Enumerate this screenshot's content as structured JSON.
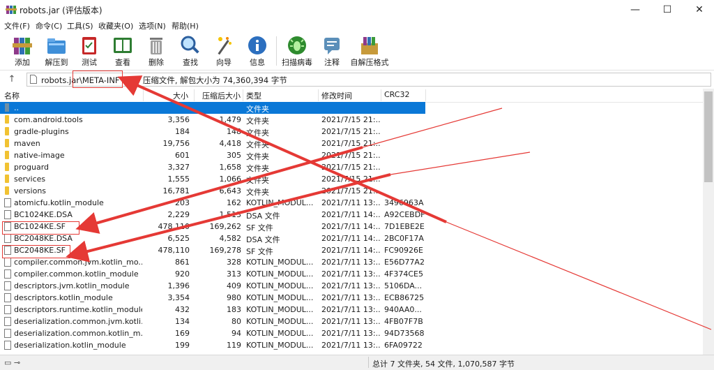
{
  "window": {
    "title": "robots.jar (评估版本)",
    "controls": {
      "minimize": "—",
      "maximize": "☐",
      "close": "✕"
    }
  },
  "menu": [
    "文件(F)",
    "命令(C)",
    "工具(S)",
    "收藏夹(O)",
    "选项(N)",
    "帮助(H)"
  ],
  "toolbar": [
    {
      "label": "添加",
      "icon": "books-add-icon"
    },
    {
      "label": "解压到",
      "icon": "folder-extract-icon"
    },
    {
      "label": "测试",
      "icon": "clipboard-test-icon"
    },
    {
      "label": "查看",
      "icon": "book-view-icon"
    },
    {
      "label": "删除",
      "icon": "trash-delete-icon"
    },
    {
      "label": "查找",
      "icon": "magnifier-find-icon"
    },
    {
      "label": "向导",
      "icon": "wand-wizard-icon"
    },
    {
      "label": "信息",
      "icon": "info-icon"
    },
    {
      "label": "扫描病毒",
      "icon": "bug-scan-icon"
    },
    {
      "label": "注释",
      "icon": "comment-icon"
    },
    {
      "label": "自解压格式",
      "icon": "sfx-box-icon"
    }
  ],
  "address": {
    "up_icon": "↑",
    "text": "robots.jar\\META-INF - ZIP 压缩文件, 解包大小为 74,360,394 字节"
  },
  "columns": {
    "name": "名称",
    "size": "大小",
    "packed": "压缩后大小",
    "type": "类型",
    "modified": "修改时间",
    "crc": "CRC32"
  },
  "rows": [
    {
      "icon": "up",
      "name": "..",
      "size": "",
      "packed": "",
      "type": "文件夹",
      "modified": "",
      "crc": "",
      "selected": true
    },
    {
      "icon": "folder",
      "name": "com.android.tools",
      "size": "3,356",
      "packed": "1,479",
      "type": "文件夹",
      "modified": "2021/7/15 21:...",
      "crc": ""
    },
    {
      "icon": "folder",
      "name": "gradle-plugins",
      "size": "184",
      "packed": "148",
      "type": "文件夹",
      "modified": "2021/7/15 21:...",
      "crc": ""
    },
    {
      "icon": "folder",
      "name": "maven",
      "size": "19,756",
      "packed": "4,418",
      "type": "文件夹",
      "modified": "2021/7/15 21:...",
      "crc": ""
    },
    {
      "icon": "folder",
      "name": "native-image",
      "size": "601",
      "packed": "305",
      "type": "文件夹",
      "modified": "2021/7/15 21:...",
      "crc": ""
    },
    {
      "icon": "folder",
      "name": "proguard",
      "size": "3,327",
      "packed": "1,658",
      "type": "文件夹",
      "modified": "2021/7/15 21:...",
      "crc": ""
    },
    {
      "icon": "folder",
      "name": "services",
      "size": "1,555",
      "packed": "1,066",
      "type": "文件夹",
      "modified": "2021/7/15 21:...",
      "crc": ""
    },
    {
      "icon": "folder",
      "name": "versions",
      "size": "16,781",
      "packed": "6,643",
      "type": "文件夹",
      "modified": "2021/7/15 21:...",
      "crc": ""
    },
    {
      "icon": "file",
      "name": "atomicfu.kotlin_module",
      "size": "203",
      "packed": "162",
      "type": "KOTLIN_MODUL...",
      "modified": "2021/7/11 13:...",
      "crc": "3496963A"
    },
    {
      "icon": "file",
      "name": "BC1024KE.DSA",
      "size": "2,229",
      "packed": "1,513",
      "type": "DSA 文件",
      "modified": "2021/7/11 14:...",
      "crc": "A92CEBDF"
    },
    {
      "icon": "file",
      "name": "BC1024KE.SF",
      "size": "478,110",
      "packed": "169,262",
      "type": "SF 文件",
      "modified": "2021/7/11 14:...",
      "crc": "7D1EBE2E"
    },
    {
      "icon": "file",
      "name": "BC2048KE.DSA",
      "size": "6,525",
      "packed": "4,582",
      "type": "DSA 文件",
      "modified": "2021/7/11 14:...",
      "crc": "2BC0F17A"
    },
    {
      "icon": "file",
      "name": "BC2048KE.SF",
      "size": "478,110",
      "packed": "169,278",
      "type": "SF 文件",
      "modified": "2021/7/11 14:...",
      "crc": "FC90926E"
    },
    {
      "icon": "file",
      "name": "compiler.common.jvm.kotlin_mo...",
      "size": "861",
      "packed": "328",
      "type": "KOTLIN_MODUL...",
      "modified": "2021/7/11 13:...",
      "crc": "E56D77A2"
    },
    {
      "icon": "file",
      "name": "compiler.common.kotlin_module",
      "size": "920",
      "packed": "313",
      "type": "KOTLIN_MODUL...",
      "modified": "2021/7/11 13:...",
      "crc": "4F374CE5"
    },
    {
      "icon": "file",
      "name": "descriptors.jvm.kotlin_module",
      "size": "1,396",
      "packed": "409",
      "type": "KOTLIN_MODUL...",
      "modified": "2021/7/11 13:...",
      "crc": "5106DA..."
    },
    {
      "icon": "file",
      "name": "descriptors.kotlin_module",
      "size": "3,354",
      "packed": "980",
      "type": "KOTLIN_MODUL...",
      "modified": "2021/7/11 13:...",
      "crc": "ECB86725"
    },
    {
      "icon": "file",
      "name": "descriptors.runtime.kotlin_module",
      "size": "432",
      "packed": "183",
      "type": "KOTLIN_MODUL...",
      "modified": "2021/7/11 13:...",
      "crc": "940AA0..."
    },
    {
      "icon": "file",
      "name": "deserialization.common.jvm.kotli...",
      "size": "134",
      "packed": "80",
      "type": "KOTLIN_MODUL...",
      "modified": "2021/7/11 13:...",
      "crc": "4FB07F7B"
    },
    {
      "icon": "file",
      "name": "deserialization.common.kotlin_m...",
      "size": "169",
      "packed": "94",
      "type": "KOTLIN_MODUL...",
      "modified": "2021/7/11 13:...",
      "crc": "94D73568"
    },
    {
      "icon": "file",
      "name": "deserialization.kotlin_module",
      "size": "199",
      "packed": "119",
      "type": "KOTLIN_MODUL...",
      "modified": "2021/7/11 13:...",
      "crc": "6FA09722"
    }
  ],
  "status": {
    "icons": "▭ ⊸",
    "text": "总计 7 文件夹, 54 文件, 1,070,587 字节"
  },
  "colors": {
    "selection": "#0a78d7",
    "annotation": "#e53935"
  }
}
